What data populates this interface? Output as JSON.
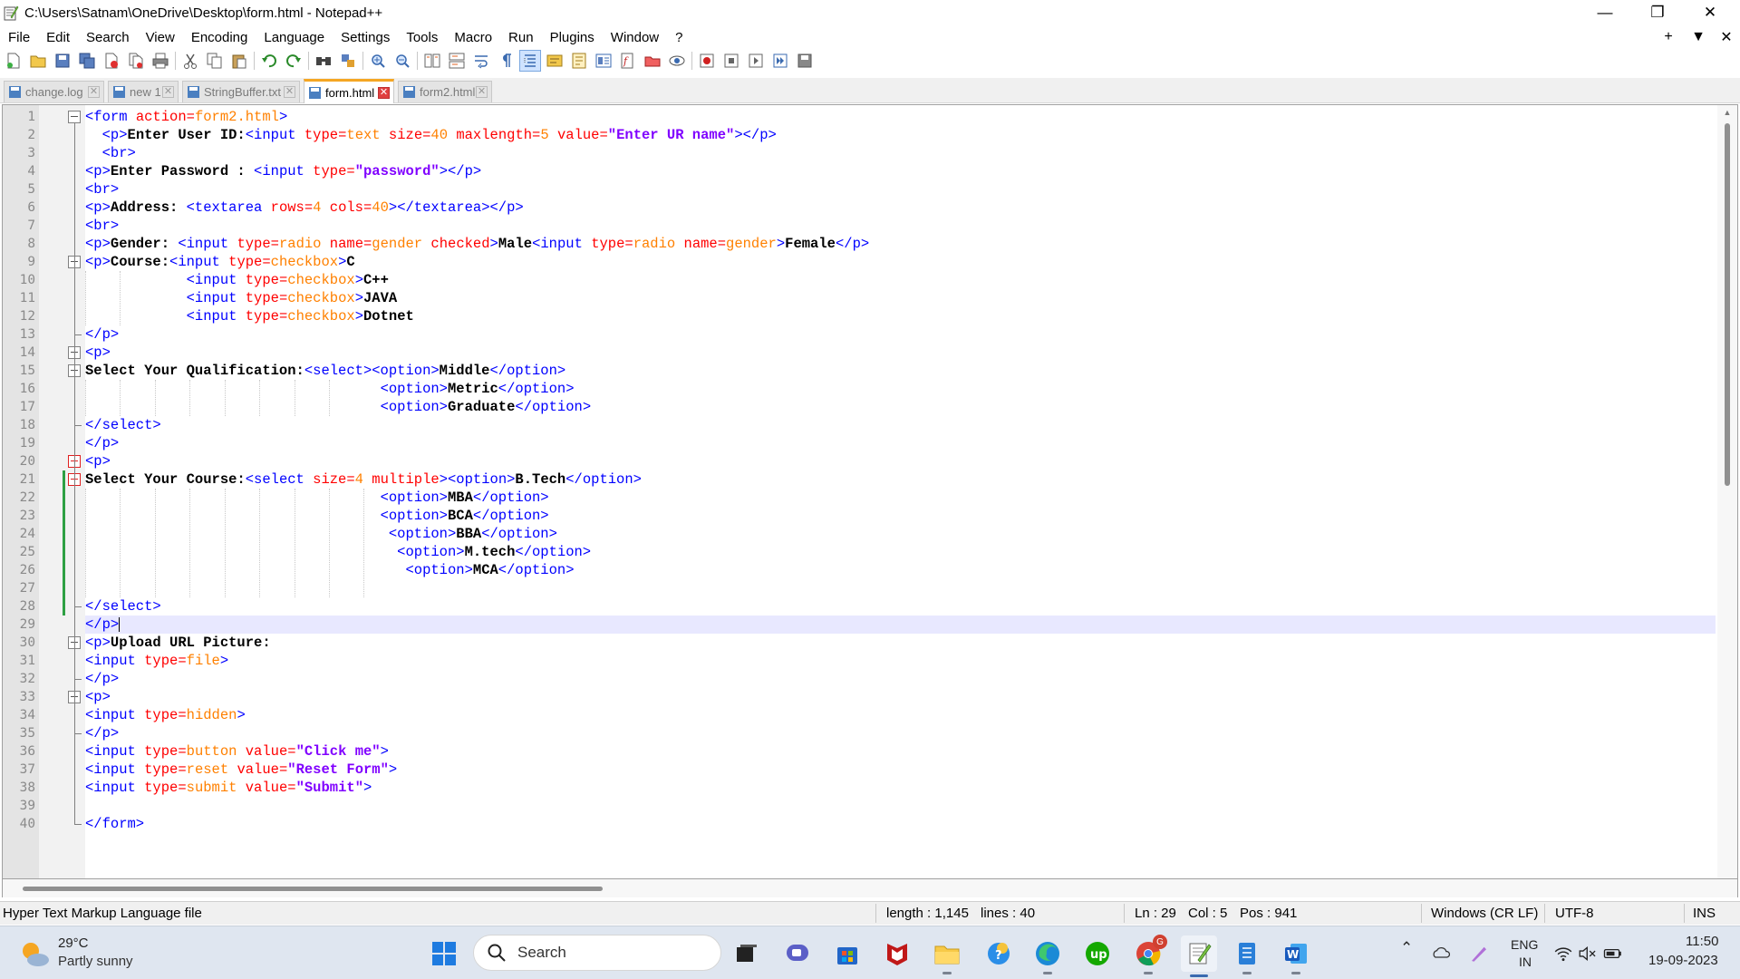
{
  "window": {
    "title": "C:\\Users\\Satnam\\OneDrive\\Desktop\\form.html - Notepad++",
    "controls": {
      "minimize": "—",
      "maximize": "❐",
      "close": "✕"
    }
  },
  "menu": {
    "items": [
      "File",
      "Edit",
      "Search",
      "View",
      "Encoding",
      "Language",
      "Settings",
      "Tools",
      "Macro",
      "Run",
      "Plugins",
      "Window",
      "?"
    ],
    "right": {
      "plus": "+",
      "dropdown": "▼",
      "close": "✕"
    }
  },
  "tabs": [
    {
      "label": "change.log",
      "active": false,
      "color": "#4a7fc0"
    },
    {
      "label": "new 1",
      "active": false,
      "color": "#4a7fc0"
    },
    {
      "label": "StringBuffer.txt",
      "active": false,
      "color": "#4a7fc0"
    },
    {
      "label": "form.html",
      "active": true,
      "color": "#4a7fc0"
    },
    {
      "label": "form2.html",
      "active": false,
      "color": "#4a7fc0"
    }
  ],
  "editor": {
    "current_line": 29,
    "lines": [
      [
        [
          "tg",
          "<form "
        ],
        [
          "at",
          "action="
        ],
        [
          "av",
          "form2.html"
        ],
        [
          "tg",
          ">"
        ]
      ],
      [
        [
          "",
          "  "
        ],
        [
          "tg",
          "<p>"
        ],
        [
          "tx",
          "Enter User ID:"
        ],
        [
          "tg",
          "<input "
        ],
        [
          "at",
          "type="
        ],
        [
          "av",
          "text"
        ],
        [
          "at",
          " size="
        ],
        [
          "av",
          "40"
        ],
        [
          "at",
          " maxlength="
        ],
        [
          "av",
          "5"
        ],
        [
          "at",
          " value="
        ],
        [
          "qs",
          "\"Enter UR name\""
        ],
        [
          "tg",
          "></p>"
        ]
      ],
      [
        [
          "",
          "  "
        ],
        [
          "tg",
          "<br>"
        ]
      ],
      [
        [
          "tg",
          "<p>"
        ],
        [
          "tx",
          "Enter Password : "
        ],
        [
          "tg",
          "<input "
        ],
        [
          "at",
          "type="
        ],
        [
          "qs",
          "\"password\""
        ],
        [
          "tg",
          "></p>"
        ]
      ],
      [
        [
          "tg",
          "<br>"
        ]
      ],
      [
        [
          "tg",
          "<p>"
        ],
        [
          "tx",
          "Address: "
        ],
        [
          "tg",
          "<textarea "
        ],
        [
          "at",
          "rows="
        ],
        [
          "av",
          "4"
        ],
        [
          "at",
          " cols="
        ],
        [
          "av",
          "40"
        ],
        [
          "tg",
          "></textarea></p>"
        ]
      ],
      [
        [
          "tg",
          "<br>"
        ]
      ],
      [
        [
          "tg",
          "<p>"
        ],
        [
          "tx",
          "Gender: "
        ],
        [
          "tg",
          "<input "
        ],
        [
          "at",
          "type="
        ],
        [
          "av",
          "radio"
        ],
        [
          "at",
          " name="
        ],
        [
          "av",
          "gender"
        ],
        [
          "at",
          " checked"
        ],
        [
          "tg",
          ">"
        ],
        [
          "tx",
          "Male"
        ],
        [
          "tg",
          "<input "
        ],
        [
          "at",
          "type="
        ],
        [
          "av",
          "radio"
        ],
        [
          "at",
          " name="
        ],
        [
          "av",
          "gender"
        ],
        [
          "tg",
          ">"
        ],
        [
          "tx",
          "Female"
        ],
        [
          "tg",
          "</p>"
        ]
      ],
      [
        [
          "tg",
          "<p>"
        ],
        [
          "tx",
          "Course:"
        ],
        [
          "tg",
          "<input "
        ],
        [
          "at",
          "type="
        ],
        [
          "av",
          "checkbox"
        ],
        [
          "tg",
          ">"
        ],
        [
          "tx",
          "C"
        ]
      ],
      [
        [
          "",
          "            "
        ],
        [
          "tg",
          "<input "
        ],
        [
          "at",
          "type="
        ],
        [
          "av",
          "checkbox"
        ],
        [
          "tg",
          ">"
        ],
        [
          "tx",
          "C++"
        ]
      ],
      [
        [
          "",
          "            "
        ],
        [
          "tg",
          "<input "
        ],
        [
          "at",
          "type="
        ],
        [
          "av",
          "checkbox"
        ],
        [
          "tg",
          ">"
        ],
        [
          "tx",
          "JAVA"
        ]
      ],
      [
        [
          "",
          "            "
        ],
        [
          "tg",
          "<input "
        ],
        [
          "at",
          "type="
        ],
        [
          "av",
          "checkbox"
        ],
        [
          "tg",
          ">"
        ],
        [
          "tx",
          "Dotnet"
        ]
      ],
      [
        [
          "tg",
          "</p>"
        ]
      ],
      [
        [
          "tg",
          "<p>"
        ]
      ],
      [
        [
          "tx",
          "Select Your Qualification:"
        ],
        [
          "tg",
          "<select><option>"
        ],
        [
          "tx",
          "Middle"
        ],
        [
          "tg",
          "</option>"
        ]
      ],
      [
        [
          "",
          "                                   "
        ],
        [
          "tg",
          "<option>"
        ],
        [
          "tx",
          "Metric"
        ],
        [
          "tg",
          "</option>"
        ]
      ],
      [
        [
          "",
          "                                   "
        ],
        [
          "tg",
          "<option>"
        ],
        [
          "tx",
          "Graduate"
        ],
        [
          "tg",
          "</option>"
        ]
      ],
      [
        [
          "tg",
          "</select>"
        ]
      ],
      [
        [
          "tg",
          "</p>"
        ]
      ],
      [
        [
          "tg",
          "<p>"
        ]
      ],
      [
        [
          "tx",
          "Select Your Course:"
        ],
        [
          "tg",
          "<select "
        ],
        [
          "at",
          "size="
        ],
        [
          "av",
          "4"
        ],
        [
          "at",
          " multiple"
        ],
        [
          "tg",
          "><option>"
        ],
        [
          "tx",
          "B.Tech"
        ],
        [
          "tg",
          "</option>"
        ]
      ],
      [
        [
          "",
          "                                   "
        ],
        [
          "tg",
          "<option>"
        ],
        [
          "tx",
          "MBA"
        ],
        [
          "tg",
          "</option>"
        ]
      ],
      [
        [
          "",
          "                                   "
        ],
        [
          "tg",
          "<option>"
        ],
        [
          "tx",
          "BCA"
        ],
        [
          "tg",
          "</option>"
        ]
      ],
      [
        [
          "",
          "                                    "
        ],
        [
          "tg",
          "<option>"
        ],
        [
          "tx",
          "BBA"
        ],
        [
          "tg",
          "</option>"
        ]
      ],
      [
        [
          "",
          "                                     "
        ],
        [
          "tg",
          "<option>"
        ],
        [
          "tx",
          "M.tech"
        ],
        [
          "tg",
          "</option>"
        ]
      ],
      [
        [
          "",
          "                                      "
        ],
        [
          "tg",
          "<option>"
        ],
        [
          "tx",
          "MCA"
        ],
        [
          "tg",
          "</option>"
        ]
      ],
      [
        [
          "",
          ""
        ]
      ],
      [
        [
          "tg",
          "</select>"
        ]
      ],
      [
        [
          "tg",
          "</p>"
        ]
      ],
      [
        [
          "tg",
          "<p>"
        ],
        [
          "tx",
          "Upload URL Picture:"
        ]
      ],
      [
        [
          "tg",
          "<input "
        ],
        [
          "at",
          "type="
        ],
        [
          "av",
          "file"
        ],
        [
          "tg",
          ">"
        ]
      ],
      [
        [
          "tg",
          "</p>"
        ]
      ],
      [
        [
          "tg",
          "<p>"
        ]
      ],
      [
        [
          "tg",
          "<input "
        ],
        [
          "at",
          "type="
        ],
        [
          "av",
          "hidden"
        ],
        [
          "tg",
          ">"
        ]
      ],
      [
        [
          "tg",
          "</p>"
        ]
      ],
      [
        [
          "tg",
          "<input "
        ],
        [
          "at",
          "type="
        ],
        [
          "av",
          "button"
        ],
        [
          "at",
          " value="
        ],
        [
          "qs",
          "\"Click me\""
        ],
        [
          "tg",
          ">"
        ]
      ],
      [
        [
          "tg",
          "<input "
        ],
        [
          "at",
          "type="
        ],
        [
          "av",
          "reset"
        ],
        [
          "at",
          " value="
        ],
        [
          "qs",
          "\"Reset Form\""
        ],
        [
          "tg",
          ">"
        ]
      ],
      [
        [
          "tg",
          "<input "
        ],
        [
          "at",
          "type="
        ],
        [
          "av",
          "submit"
        ],
        [
          "at",
          " value="
        ],
        [
          "qs",
          "\"Submit\""
        ],
        [
          "tg",
          ">"
        ]
      ],
      [
        [
          "",
          ""
        ]
      ],
      [
        [
          "tg",
          "</form>"
        ]
      ]
    ]
  },
  "status": {
    "file_type": "Hyper Text Markup Language file",
    "length": "length : 1,145",
    "lines": "lines : 40",
    "ln": "Ln : 29",
    "col": "Col : 5",
    "pos": "Pos : 941",
    "eol": "Windows (CR LF)",
    "encoding": "UTF-8",
    "mode": "INS"
  },
  "taskbar": {
    "weather_temp": "29°C",
    "weather_desc": "Partly sunny",
    "search_placeholder": "Search",
    "lang_top": "ENG",
    "lang_bottom": "IN",
    "time": "11:50",
    "date": "19-09-2023",
    "chrome_badge": "G"
  }
}
